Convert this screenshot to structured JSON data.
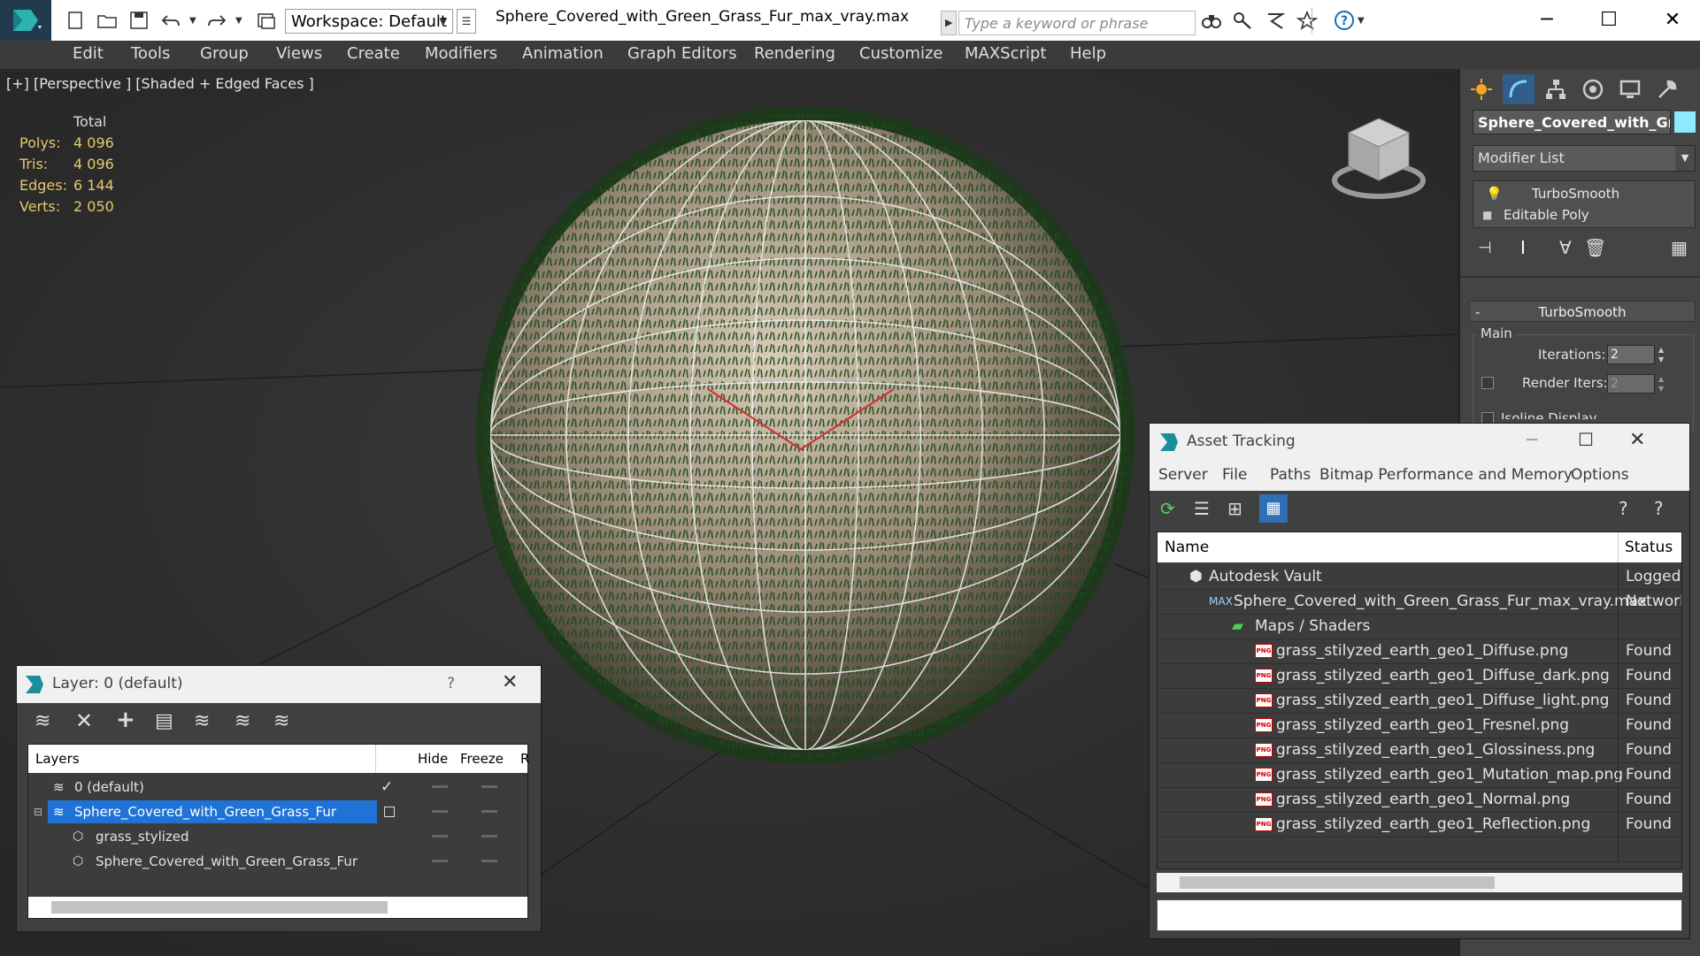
{
  "titlebar": {
    "workspace_label": "Workspace: Default",
    "document_title": "Sphere_Covered_with_Green_Grass_Fur_max_vray.max",
    "search_placeholder": "Type a keyword or phrase"
  },
  "menu": {
    "items": [
      "Edit",
      "Tools",
      "Group",
      "Views",
      "Create",
      "Modifiers",
      "Animation",
      "Graph Editors",
      "Rendering",
      "Customize",
      "MAXScript",
      "Help"
    ]
  },
  "viewport": {
    "label": "[+] [Perspective ] [Shaded + Edged Faces ]",
    "stats": {
      "header": "Total",
      "rows": [
        {
          "label": "Polys:",
          "value": "4 096"
        },
        {
          "label": "Tris:",
          "value": "4 096"
        },
        {
          "label": "Edges:",
          "value": "6 144"
        },
        {
          "label": "Verts:",
          "value": "2 050"
        }
      ]
    }
  },
  "command_panel": {
    "object_name": "Sphere_Covered_with_Green_Grass_Fur",
    "object_color": "#8ee9ff",
    "modifier_list_label": "Modifier List",
    "stack": [
      "TurboSmooth",
      "Editable Poly"
    ],
    "rollout_title": "TurboSmooth",
    "group_label": "Main",
    "iterations_label": "Iterations:",
    "iterations_value": "2",
    "render_iters_label": "Render Iters:",
    "render_iters_value": "2",
    "isoline_label": "Isoline Display"
  },
  "layer_window": {
    "title": "Layer: 0 (default)",
    "help": "?",
    "columns": [
      "Layers",
      "Hide",
      "Freeze",
      "R"
    ],
    "rows": [
      {
        "name": "0 (default)",
        "check": "✓"
      },
      {
        "name": "Sphere_Covered_with_Green_Grass_Fur"
      },
      {
        "name": "grass_stylized"
      },
      {
        "name": "Sphere_Covered_with_Green_Grass_Fur"
      }
    ]
  },
  "asset_window": {
    "title": "Asset Tracking",
    "menu": [
      "Server",
      "File",
      "Paths",
      "Bitmap Performance and Memory",
      "Options"
    ],
    "columns": {
      "name": "Name",
      "status": "Status"
    },
    "rows": [
      {
        "name": "Autodesk Vault",
        "status": "Logged Out",
        "indent": 0,
        "icon": "vault"
      },
      {
        "name": "Sphere_Covered_with_Green_Grass_Fur_max_vray.max",
        "status": "Network",
        "indent": 1,
        "icon": "max"
      },
      {
        "name": "Maps / Shaders",
        "status": "",
        "indent": 2,
        "icon": "maps"
      },
      {
        "name": "grass_stilyzed_earth_geo1_Diffuse.png",
        "status": "Found",
        "indent": 3,
        "icon": "png"
      },
      {
        "name": "grass_stilyzed_earth_geo1_Diffuse_dark.png",
        "status": "Found",
        "indent": 3,
        "icon": "png"
      },
      {
        "name": "grass_stilyzed_earth_geo1_Diffuse_light.png",
        "status": "Found",
        "indent": 3,
        "icon": "png"
      },
      {
        "name": "grass_stilyzed_earth_geo1_Fresnel.png",
        "status": "Found",
        "indent": 3,
        "icon": "png"
      },
      {
        "name": "grass_stilyzed_earth_geo1_Glossiness.png",
        "status": "Found",
        "indent": 3,
        "icon": "png"
      },
      {
        "name": "grass_stilyzed_earth_geo1_Mutation_map.png",
        "status": "Found",
        "indent": 3,
        "icon": "png"
      },
      {
        "name": "grass_stilyzed_earth_geo1_Normal.png",
        "status": "Found",
        "indent": 3,
        "icon": "png"
      },
      {
        "name": "grass_stilyzed_earth_geo1_Reflection.png",
        "status": "Found",
        "indent": 3,
        "icon": "png"
      }
    ]
  },
  "colors": {
    "selection_blue": "#1f73d6",
    "stats_yellow": "#e7c86a",
    "grass_green": "#2d5a24"
  }
}
